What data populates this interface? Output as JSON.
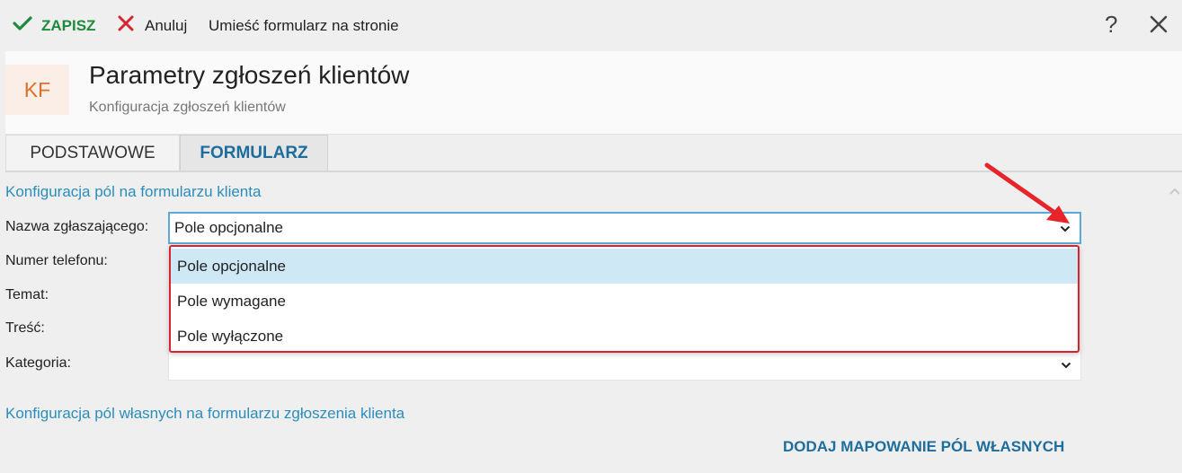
{
  "toolbar": {
    "save_label": "ZAPISZ",
    "cancel_label": "Anuluj",
    "place_form_label": "Umieść formularz na stronie",
    "help_label": "?"
  },
  "header": {
    "badge": "KF",
    "title": "Parametry zgłoszeń klientów",
    "subtitle": "Konfiguracja zgłoszeń klientów"
  },
  "tabs": [
    {
      "label": "PODSTAWOWE",
      "active": false
    },
    {
      "label": "FORMULARZ",
      "active": true
    }
  ],
  "sections": {
    "fields_config": "Konfiguracja pól na formularzu klienta",
    "custom_fields_config": "Konfiguracja pól własnych na formularzu zgłoszenia klienta"
  },
  "fields": [
    {
      "label": "Nazwa zgłaszającego:",
      "value": "Pole opcjonalne"
    },
    {
      "label": "Numer telefonu:",
      "value": ""
    },
    {
      "label": "Temat:",
      "value": ""
    },
    {
      "label": "Treść:",
      "value": ""
    },
    {
      "label": "Kategoria:",
      "value": ""
    }
  ],
  "dropdown": {
    "options": [
      "Pole opcjonalne",
      "Pole wymagane",
      "Pole wyłączone"
    ],
    "selected": "Pole opcjonalne"
  },
  "actions": {
    "add_mapping": "DODAJ MAPOWANIE PÓL WŁASNYCH"
  },
  "colors": {
    "accent": "#2b8dbc",
    "save_green": "#1e8a3c",
    "cancel_red": "#d9232e",
    "badge_orange": "#d9702c",
    "highlight_red": "#d9232e"
  }
}
